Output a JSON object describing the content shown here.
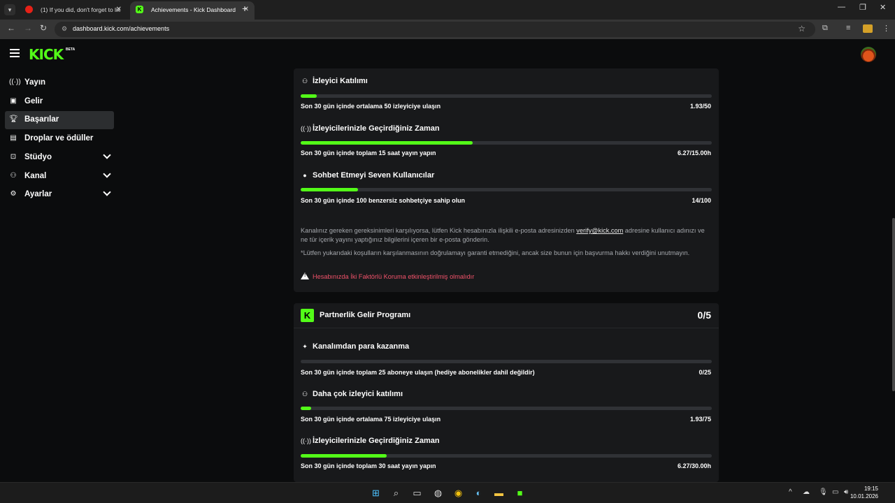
{
  "browser": {
    "tabs": [
      {
        "title": "(1) If you did, don't forget to lik"
      },
      {
        "title": "Achievements - Kick Dashboard"
      }
    ],
    "url": "dashboard.kick.com/achievements"
  },
  "app": {
    "logo": "KICK",
    "logo_badge": "BETA"
  },
  "sidebar": {
    "items": [
      {
        "label": "Yayın",
        "icon": "broadcast-icon"
      },
      {
        "label": "Gelir",
        "icon": "revenue-icon"
      },
      {
        "label": "Başarılar",
        "icon": "trophy-icon",
        "active": true
      },
      {
        "label": "Droplar ve ödüller",
        "icon": "gift-icon"
      },
      {
        "label": "Stüdyo",
        "icon": "studio-icon",
        "expandable": true
      },
      {
        "label": "Kanal",
        "icon": "channel-icon",
        "expandable": true
      },
      {
        "label": "Ayarlar",
        "icon": "gear-icon",
        "expandable": true
      }
    ]
  },
  "card1": {
    "sections": [
      {
        "title": "İzleyici Katılımı",
        "icon": "viewers-icon",
        "requirement": "Son 30 gün içinde ortalama 50 izleyiciye ulaşın",
        "value": "1.93/50",
        "progress": 0.0386
      },
      {
        "title": "İzleyicilerinizle Geçirdiğiniz Zaman",
        "icon": "broadcast-icon",
        "requirement": "Son 30 gün içinde toplam 15 saat yayın yapın",
        "value": "6.27/15.00h",
        "progress": 0.418
      },
      {
        "title": "Sohbet Etmeyi Seven Kullanıcılar",
        "icon": "chat-icon",
        "requirement": "Son 30 gün içinde 100 benzersiz sohbetçiye sahip olun",
        "value": "14/100",
        "progress": 0.14
      }
    ],
    "note1_before": "Kanalınız gereken gereksinimleri karşılıyorsa, lütfen Kick hesabınızla ilişkili e-posta adresinizden ",
    "note1_link": "verify@kick.com",
    "note1_after": " adresine kullanıcı adınızı ve ne tür içerik yayını yaptığınız bilgilerini içeren bir e-posta gönderin.",
    "note2": "*Lütfen yukarıdaki koşulların karşılanmasının doğrulamayı garanti etmediğini, ancak size bunun için başvurma hakkı verdiğini unutmayın.",
    "warning": "Hesabınızda İki Faktörlü Koruma etkinleştirilmiş olmalıdır"
  },
  "card2": {
    "logo_letter": "K",
    "title": "Partnerlik Gelir Programı",
    "count": "0/5",
    "sections": [
      {
        "title": "Kanalımdan para kazanma",
        "icon": "sparkle-icon",
        "requirement": "Son 30 gün içinde toplam 25 aboneye ulaşın (hediye abonelikler dahil değildir)",
        "value": "0/25",
        "progress": 0
      },
      {
        "title": "Daha çok izleyici katılımı",
        "icon": "viewers-icon",
        "requirement": "Son 30 gün içinde ortalama 75 izleyiciye ulaşın",
        "value": "1.93/75",
        "progress": 0.0257
      },
      {
        "title": "İzleyicilerinizle Geçirdiğiniz Zaman",
        "icon": "broadcast-icon",
        "requirement": "Son 30 gün içinde toplam 30 saat yayın yapın",
        "value": "6.27/30.00h",
        "progress": 0.209
      }
    ]
  },
  "taskbar": {
    "time": "19:15",
    "date": "10.01.2026"
  },
  "colors": {
    "accent": "#53fc18",
    "warning": "#f0526a",
    "card": "#18191b",
    "background": "#0b0c0d"
  }
}
